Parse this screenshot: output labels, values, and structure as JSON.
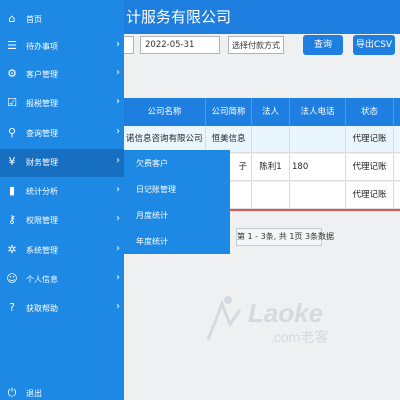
{
  "header": {
    "title": "计服务有限公司"
  },
  "filters": {
    "date_value": "2022-05-31",
    "payment_select": "选择付款方式",
    "search_label": "查询",
    "export_label": "导出CSV"
  },
  "table": {
    "headers": [
      "公司名称",
      "公司简称",
      "法人",
      "法人电话",
      "状态"
    ],
    "rows": [
      [
        "诺信息咨询有限公司",
        "恒美信息",
        "",
        "",
        "代理记账"
      ],
      [
        "",
        "子",
        "陈利1",
        "180",
        "代理记账"
      ],
      [
        "",
        "",
        "",
        "",
        "代理记账"
      ]
    ]
  },
  "pager": {
    "text": "第 1 - 3条, 共 1页 3条数据"
  },
  "sidebar": {
    "items": [
      {
        "label": "首页",
        "icon": "home-icon",
        "glyph": "⌂",
        "arrow": false
      },
      {
        "label": "待办事项",
        "icon": "list-icon",
        "glyph": "☰",
        "arrow": true
      },
      {
        "label": "客户管理",
        "icon": "cogs-icon",
        "glyph": "⚙",
        "arrow": true
      },
      {
        "label": "报税管理",
        "icon": "checkbox-icon",
        "glyph": "☑",
        "arrow": true
      },
      {
        "label": "查询管理",
        "icon": "search-icon",
        "glyph": "⚲",
        "arrow": true
      },
      {
        "label": "财务管理",
        "icon": "yen-icon",
        "glyph": "¥",
        "arrow": true
      },
      {
        "label": "统计分析",
        "icon": "bar-chart-icon",
        "glyph": "▮",
        "arrow": true
      },
      {
        "label": "权限管理",
        "icon": "key-icon",
        "glyph": "⚷",
        "arrow": true
      },
      {
        "label": "系统管理",
        "icon": "gear-icon",
        "glyph": "✲",
        "arrow": true
      },
      {
        "label": "个人信息",
        "icon": "user-icon",
        "glyph": "☺",
        "arrow": true
      },
      {
        "label": "获取帮助",
        "icon": "help-icon",
        "glyph": "?",
        "arrow": true
      },
      {
        "label": "退出",
        "icon": "power-icon",
        "glyph": "⏻",
        "arrow": false
      }
    ]
  },
  "submenu": {
    "items": [
      "欠费客户",
      "日记账管理",
      "月度统计",
      "年度统计"
    ]
  },
  "watermark": {
    "text": "Laoke",
    "subtext": ".com老客"
  },
  "colors": {
    "primary": "#1e88e5",
    "header": "#1f7fe0",
    "row_highlight": "#eaf6fd"
  }
}
